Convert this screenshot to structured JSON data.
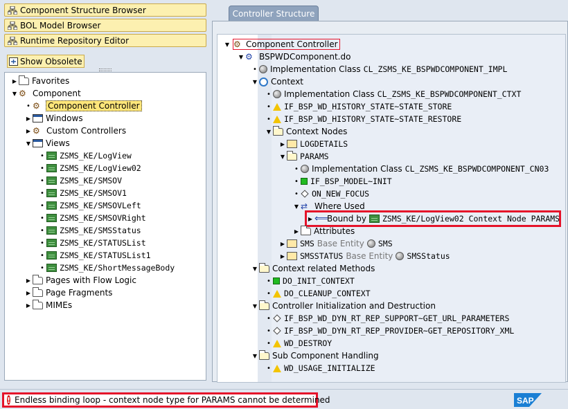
{
  "nav": {
    "component_structure_browser": "Component Structure Browser",
    "bol_model_browser": "BOL Model Browser",
    "runtime_repository_editor": "Runtime Repository Editor",
    "show_obsolete": "Show Obsolete"
  },
  "left_tree": {
    "favorites": "Favorites",
    "component": "Component",
    "component_controller": "Component Controller",
    "windows": "Windows",
    "custom_controllers": "Custom Controllers",
    "views": "Views",
    "view_items": [
      "ZSMS_KE/LogView",
      "ZSMS_KE/LogView02",
      "ZSMS_KE/SMSOV",
      "ZSMS_KE/SMSOV1",
      "ZSMS_KE/SMSOVLeft",
      "ZSMS_KE/SMSOVRight",
      "ZSMS_KE/SMSStatus",
      "ZSMS_KE/STATUSList",
      "ZSMS_KE/STATUSList1",
      "ZSMS_KE/ShortMessageBody"
    ],
    "pages_with_flow_logic": "Pages with Flow Logic",
    "page_fragments": "Page Fragments",
    "mimes": "MIMEs"
  },
  "right_panel": {
    "tab_label": "Controller Structure",
    "rows": {
      "component_controller": "Component Controller",
      "bspwdcomponent": "BSPWDComponent.do",
      "impl_class_label": "Implementation Class",
      "impl_class_value": "CL_ZSMS_KE_BSPWDCOMPONENT_IMPL",
      "context": "Context",
      "ctx_impl_class_value": "CL_ZSMS_KE_BSPWDCOMPONENT_CTXT",
      "history_store": "IF_BSP_WD_HISTORY_STATE~STATE_STORE",
      "history_restore": "IF_BSP_WD_HISTORY_STATE~STATE_RESTORE",
      "context_nodes": "Context Nodes",
      "logdetails": "LOGDETAILS",
      "params": "PARAMS",
      "params_impl_class_value": "CL_ZSMS_KE_BSPWDCOMPONENT_CN03",
      "model_init": "IF_BSP_MODEL~INIT",
      "on_new_focus": "ON_NEW_FOCUS",
      "where_used": "Where Used",
      "bound_by": "Bound by",
      "bound_by_value": "ZSMS_KE/LogView02 Context Node PARAMS",
      "attributes": "Attributes",
      "sms": "SMS",
      "base_entity": "Base Entity",
      "sms_entity": "SMS",
      "smsstatus": "SMSSTATUS",
      "smsstatus_entity": "SMSStatus",
      "context_related_methods": "Context related Methods",
      "do_init_context": "DO_INIT_CONTEXT",
      "do_cleanup_context": "DO_CLEANUP_CONTEXT",
      "controller_init_destruction": "Controller Initialization and Destruction",
      "get_url_parameters": "IF_BSP_WD_DYN_RT_REP_SUPPORT~GET_URL_PARAMETERS",
      "get_repository_xml": "IF_BSP_WD_DYN_RT_REP_PROVIDER~GET_REPOSITORY_XML",
      "wd_destroy": "WD_DESTROY",
      "sub_component_handling": "Sub Component Handling",
      "wd_usage_initialize": "WD_USAGE_INITIALIZE"
    }
  },
  "status_bar": {
    "message": "Endless binding loop - context node type for PARAMS cannot be determined",
    "logo": "SAP"
  },
  "colors": {
    "highlight_red": "#e5132a",
    "nav_button": "#fcf0b0",
    "tab": "#8fa3bd"
  }
}
